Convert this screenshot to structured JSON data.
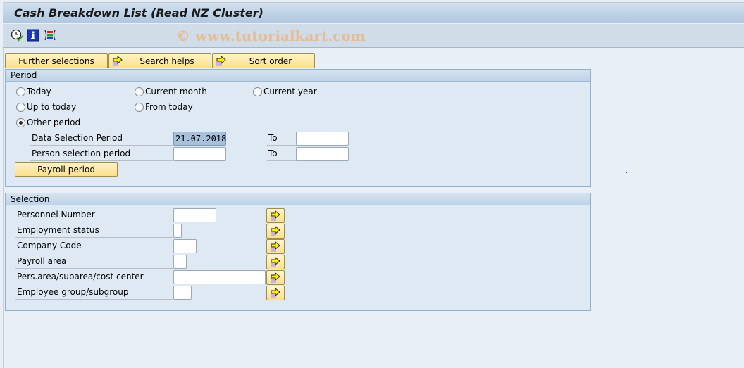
{
  "window": {
    "title": "Cash Breakdown List (Read NZ Cluster)"
  },
  "toolbar": {
    "icons": [
      {
        "name": "execute-clock-icon",
        "tooltip": "Execute"
      },
      {
        "name": "information-icon",
        "tooltip": "Information"
      },
      {
        "name": "selection-screen-icon",
        "tooltip": "Selection options"
      }
    ],
    "watermark": "© www.tutorialkart.com"
  },
  "action_buttons": {
    "further_selections": "Further selections",
    "search_helps": "Search helps",
    "sort_order": "Sort order"
  },
  "period": {
    "header": "Period",
    "radios": [
      {
        "label": "Today",
        "selected": false
      },
      {
        "label": "Current month",
        "selected": false
      },
      {
        "label": "Current year",
        "selected": false
      },
      {
        "label": "Up to today",
        "selected": false
      },
      {
        "label": "From today",
        "selected": false
      },
      {
        "label": "Other period",
        "selected": true
      }
    ],
    "data_selection_label": "Data Selection Period",
    "data_selection_from": "21.07.2018",
    "data_selection_to": "",
    "person_selection_label": "Person selection period",
    "person_selection_from": "",
    "person_selection_to": "",
    "to_label": "To",
    "payroll_period_button": "Payroll period"
  },
  "selection": {
    "header": "Selection",
    "fields": [
      {
        "label": "Personnel Number",
        "value": ""
      },
      {
        "label": "Employment status",
        "value": ""
      },
      {
        "label": "Company Code",
        "value": ""
      },
      {
        "label": "Payroll area",
        "value": ""
      },
      {
        "label": "Pers.area/subarea/cost center",
        "value": ""
      },
      {
        "label": "Employee group/subgroup",
        "value": ""
      }
    ]
  },
  "colors": {
    "button_yellow": "#fbe08a",
    "group_bg": "#dfe9f3",
    "page_bg": "#e8eff7",
    "watermark": "#e9b98c"
  }
}
